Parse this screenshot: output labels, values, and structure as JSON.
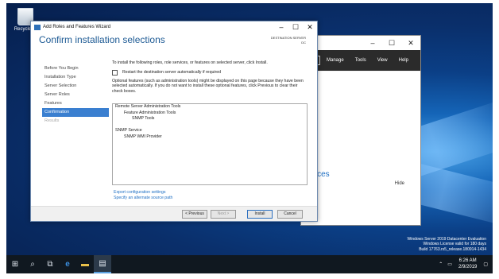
{
  "desktop": {
    "recycle_bin_label": "Recycle Bi",
    "watermark": [
      "Windows Server 2019 Datacenter Evaluation",
      "Windows License valid for 180 days",
      "Build 17763.rs5_release.180914-1434"
    ]
  },
  "server_manager": {
    "menu": [
      "Manage",
      "Tools",
      "View",
      "Help"
    ],
    "services_text": "ervices",
    "hide_label": "Hide"
  },
  "wizard": {
    "window_title": "Add Roles and Features Wizard",
    "heading": "Confirm installation selections",
    "destination_label": "DESTINATION SERVER",
    "destination_value": "DC",
    "nav": [
      {
        "label": "Before You Begin",
        "state": "normal"
      },
      {
        "label": "Installation Type",
        "state": "normal"
      },
      {
        "label": "Server Selection",
        "state": "normal"
      },
      {
        "label": "Server Roles",
        "state": "normal"
      },
      {
        "label": "Features",
        "state": "normal"
      },
      {
        "label": "Confirmation",
        "state": "active"
      },
      {
        "label": "Results",
        "state": "dim"
      }
    ],
    "intro": "To install the following roles, role services, or features on selected server, click Install.",
    "restart_checkbox": "Restart the destination server automatically if required",
    "optional_text": "Optional features (such as administration tools) might be displayed on this page because they have been selected automatically. If you do not want to install these optional features, click Previous to clear their check boxes.",
    "selections": [
      {
        "label": "Remote Server Administration Tools",
        "level": 0
      },
      {
        "label": "Feature Administration Tools",
        "level": 1
      },
      {
        "label": "SNMP Tools",
        "level": 2
      },
      {
        "label": "",
        "level": 0
      },
      {
        "label": "SNMP Service",
        "level": 0
      },
      {
        "label": "SNMP WMI Provider",
        "level": 1
      }
    ],
    "export_link": "Export configuration settings",
    "alt_source_link": "Specify an alternate source path",
    "buttons": {
      "previous": "< Previous",
      "next": "Next >",
      "install": "Install",
      "cancel": "Cancel"
    }
  },
  "taskbar": {
    "time": "6:26 AM",
    "date": "2/9/2019"
  }
}
